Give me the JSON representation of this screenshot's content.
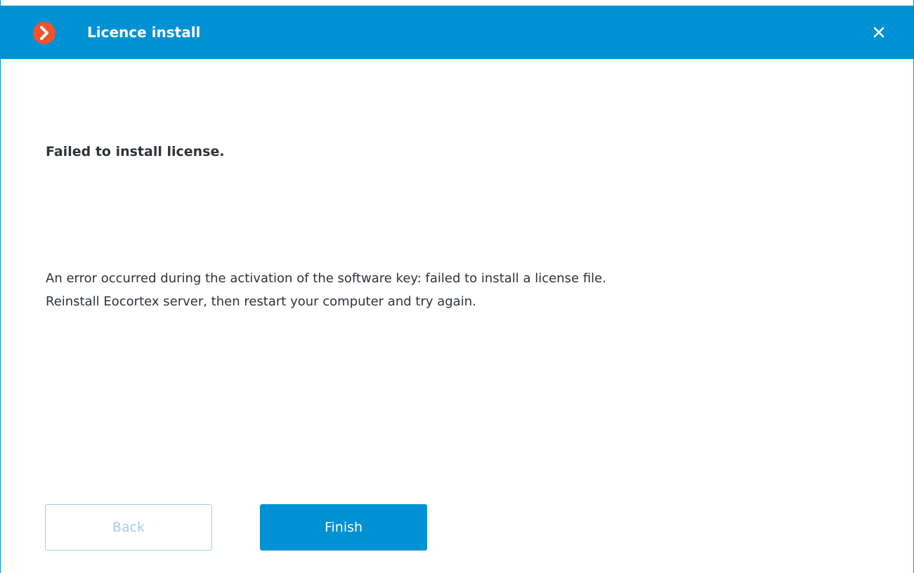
{
  "window": {
    "title": "Licence install",
    "app_icon": "chevron-right-icon",
    "close_icon": "close-icon",
    "accent_color": "#0091d4",
    "icon_color": "#f0532e"
  },
  "content": {
    "heading": "Failed to install license.",
    "message_lines": [
      "An error occurred during the activation of the software key: failed to install a license file.",
      "Reinstall Eocortex server, then restart your computer and try again."
    ]
  },
  "buttons": {
    "back_label": "Back",
    "back_enabled": false,
    "finish_label": "Finish"
  }
}
